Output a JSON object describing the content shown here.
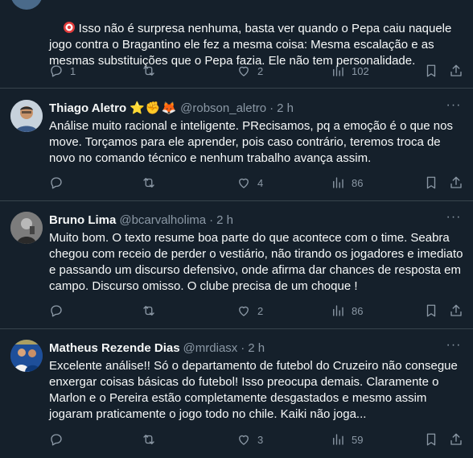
{
  "tweets": [
    {
      "author": "",
      "handle": "",
      "time": "",
      "text": "Isso não é surpresa nenhuma, basta ver quando o Pepa caiu naquele jogo contra o Bragantino ele fez a mesma coisa: Mesma escalação e as mesmas substituições que o Pepa fazia. Ele não tem personalidade.",
      "replies": "1",
      "retweets": "",
      "likes": "2",
      "views": "102"
    },
    {
      "author": "Thiago Aletro",
      "emojis": "⭐✊🦊",
      "handle": "@robson_aletro",
      "time": "2 h",
      "text": "Análise muito racional e inteligente. PRecisamos, pq a emoção é o que nos move. Torçamos para ele aprender, pois caso contrário, teremos troca de novo no comando técnico e nenhum trabalho avança assim.",
      "replies": "",
      "retweets": "",
      "likes": "4",
      "views": "86"
    },
    {
      "author": "Bruno Lima",
      "handle": "@bcarvalholima",
      "time": "2 h",
      "text": "Muito bom. O texto resume boa parte do que acontece com o time. Seabra chegou com receio de perder o vestiário, não tirando os jogadores e imediato e passando um discurso defensivo, onde afirma dar chances de resposta em campo. Discurso omisso. O clube precisa de um choque !",
      "replies": "",
      "retweets": "",
      "likes": "2",
      "views": "86"
    },
    {
      "author": "Matheus Rezende Dias",
      "handle": "@mrdiasx",
      "time": "2 h",
      "text": "Excelente análise!! Só o departamento de futebol do Cruzeiro não consegue enxergar coisas básicas do futebol! Isso preocupa demais. Claramente o Marlon e o Pereira estão completamente desgastados e mesmo assim jogaram praticamente o jogo todo no chile. Kaiki não joga...",
      "replies": "",
      "retweets": "",
      "likes": "3",
      "views": "59"
    }
  ],
  "colors": {
    "background": "#15202b",
    "text": "#f7f9f9",
    "muted": "#8b98a5",
    "divider": "#38444d"
  },
  "icons": [
    "reply-icon",
    "retweet-icon",
    "like-icon",
    "views-icon",
    "bookmark-icon",
    "share-icon",
    "more-icon"
  ]
}
